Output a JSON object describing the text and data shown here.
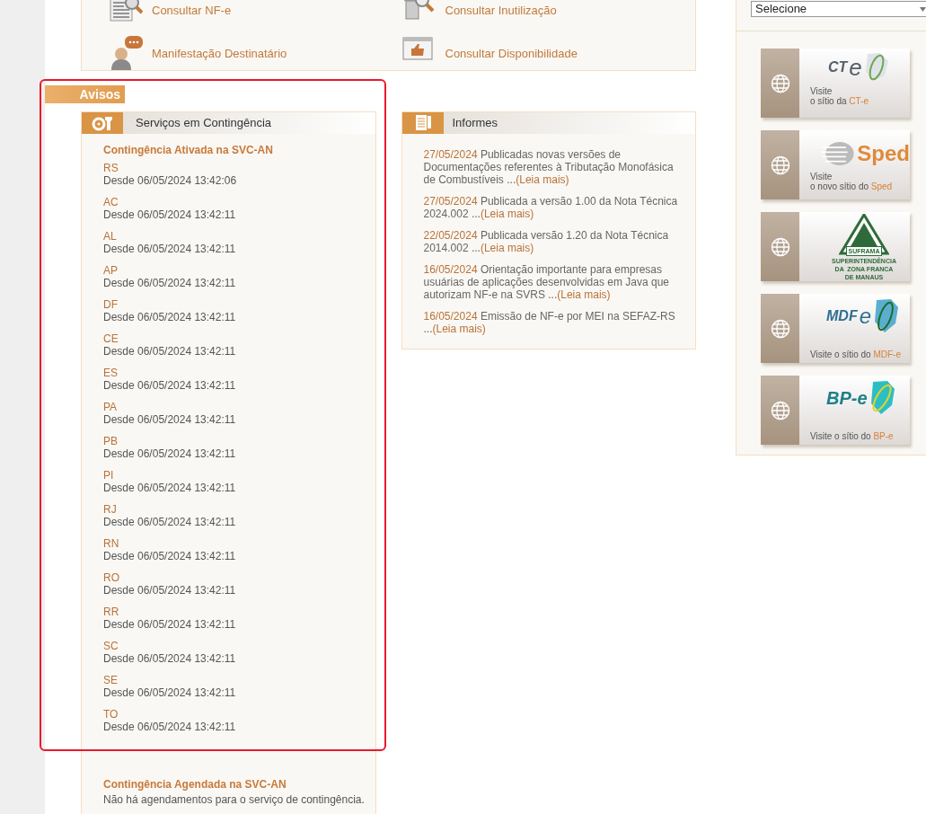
{
  "services": [
    {
      "kind": "document",
      "label": "Consultar NF-e"
    },
    {
      "kind": "trash",
      "label": "Consultar Inutilização"
    },
    {
      "kind": "person",
      "label": "Manifestação Destinatário"
    },
    {
      "kind": "thumb",
      "label": "Consultar Disponibilidade"
    }
  ],
  "avisos": {
    "title": "Avisos",
    "contingencia": {
      "title": "Serviços em Contingência",
      "active_title": "Contingência Ativada na SVC-AN",
      "states": [
        {
          "uf": "RS",
          "since": "Desde 06/05/2024 13:42:06"
        },
        {
          "uf": "AC",
          "since": "Desde 06/05/2024 13:42:11"
        },
        {
          "uf": "AL",
          "since": "Desde 06/05/2024 13:42:11"
        },
        {
          "uf": "AP",
          "since": "Desde 06/05/2024 13:42:11"
        },
        {
          "uf": "DF",
          "since": "Desde 06/05/2024 13:42:11"
        },
        {
          "uf": "CE",
          "since": "Desde 06/05/2024 13:42:11"
        },
        {
          "uf": "ES",
          "since": "Desde 06/05/2024 13:42:11"
        },
        {
          "uf": "PA",
          "since": "Desde 06/05/2024 13:42:11"
        },
        {
          "uf": "PB",
          "since": "Desde 06/05/2024 13:42:11"
        },
        {
          "uf": "PI",
          "since": "Desde 06/05/2024 13:42:11"
        },
        {
          "uf": "RJ",
          "since": "Desde 06/05/2024 13:42:11"
        },
        {
          "uf": "RN",
          "since": "Desde 06/05/2024 13:42:11"
        },
        {
          "uf": "RO",
          "since": "Desde 06/05/2024 13:42:11"
        },
        {
          "uf": "RR",
          "since": "Desde 06/05/2024 13:42:11"
        },
        {
          "uf": "SC",
          "since": "Desde 06/05/2024 13:42:11"
        },
        {
          "uf": "SE",
          "since": "Desde 06/05/2024 13:42:11"
        },
        {
          "uf": "TO",
          "since": "Desde 06/05/2024 13:42:11"
        }
      ],
      "scheduled_title": "Contingência Agendada na SVC-AN",
      "scheduled_text": "Não há agendamentos para o serviço de contingência."
    },
    "informes": {
      "title": "Informes",
      "items": [
        {
          "date": "27/05/2024",
          "text": "Publicadas novas versões de Documentações referentes à Tributação Monofásica de Combustíveis ...",
          "link": "(Leia mais)"
        },
        {
          "date": "27/05/2024",
          "text": "Publicada a versão 1.00 da Nota Técnica 2024.002 ...",
          "link": "(Leia mais)"
        },
        {
          "date": "22/05/2024",
          "text": "Publicada versão 1.20 da Nota Técnica 2014.002 ...",
          "link": "(Leia mais)"
        },
        {
          "date": "16/05/2024",
          "text": "Orientação importante para empresas usuárias de aplicações desenvolvidas em Java que autorizam NF-e na SVRS ...",
          "link": "(Leia mais)"
        },
        {
          "date": "16/05/2024",
          "text": "Emissão de NF-e por MEI na SEFAZ-RS ...",
          "link": "(Leia mais)"
        }
      ]
    }
  },
  "sidebar": {
    "select": {
      "value": "Selecione"
    },
    "banners": [
      {
        "kind": "cte",
        "logo": [
          "CT",
          "e"
        ],
        "lines": [
          "Visite"
        ],
        "text": "o sítio da ",
        "highlight": "CT-e"
      },
      {
        "kind": "sped",
        "logo": [
          "Sped"
        ],
        "lines": [
          "Visite"
        ],
        "text": "o novo sítio do ",
        "highlight": "Sped"
      },
      {
        "kind": "suframa",
        "logo": [
          "SUFRAMA",
          "SUPERINTENDÊNCIA",
          "DA  ZONA FRANCA",
          "DE MANAUS"
        ]
      },
      {
        "kind": "mdfe",
        "logo": [
          "MDF",
          "e"
        ],
        "text": "Visite o sítio do ",
        "highlight": "MDF-e"
      },
      {
        "kind": "bpe",
        "logo": [
          "BP-e"
        ],
        "text": "Visite o sítio do ",
        "highlight": "BP-e"
      }
    ]
  },
  "annotation": {
    "kind": "highlight-box"
  }
}
